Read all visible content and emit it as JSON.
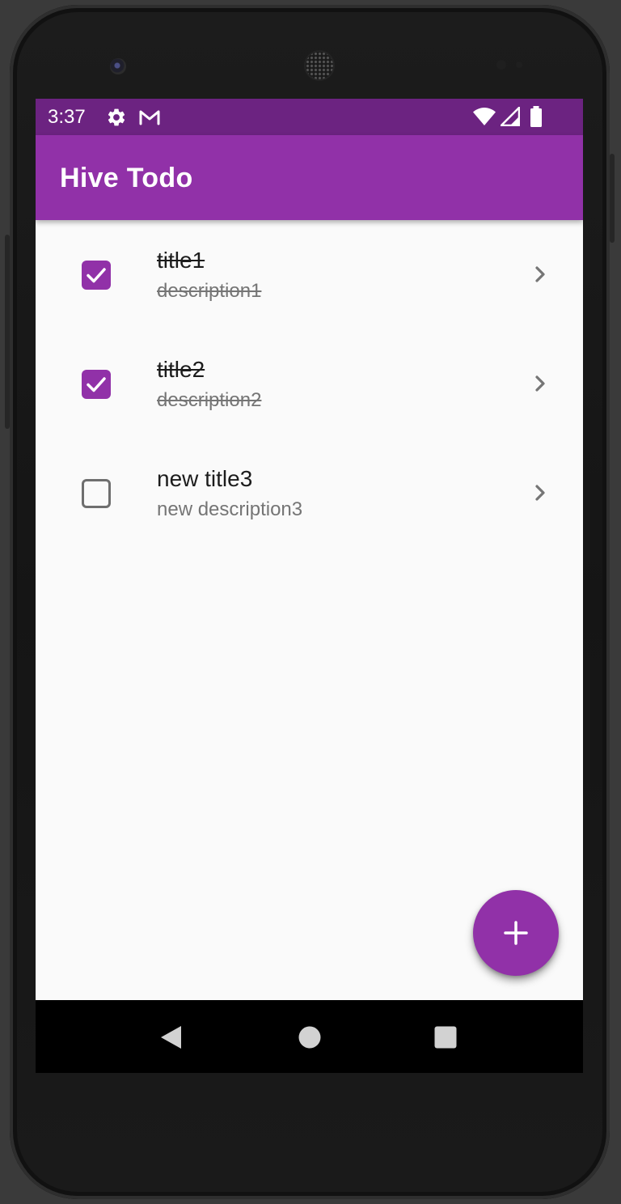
{
  "status_bar": {
    "time": "3:37",
    "left_icons": [
      "gear-icon",
      "gmail-icon"
    ],
    "right_icons": [
      "wifi-icon",
      "signal-icon",
      "battery-icon"
    ]
  },
  "app_bar": {
    "title": "Hive Todo"
  },
  "todos": [
    {
      "title": "title1",
      "description": "description1",
      "completed": true
    },
    {
      "title": "title2",
      "description": "description2",
      "completed": true
    },
    {
      "title": "new title3",
      "description": "new description3",
      "completed": false
    }
  ],
  "fab": {
    "icon": "plus-icon"
  },
  "nav_bar": {
    "buttons": [
      "back-icon",
      "home-icon",
      "recents-icon"
    ]
  },
  "colors": {
    "primary": "#9131a8",
    "primary_dark": "#6c2381",
    "background": "#fafafa",
    "title_text": "#1c1c1c",
    "secondary_text": "#757575"
  }
}
